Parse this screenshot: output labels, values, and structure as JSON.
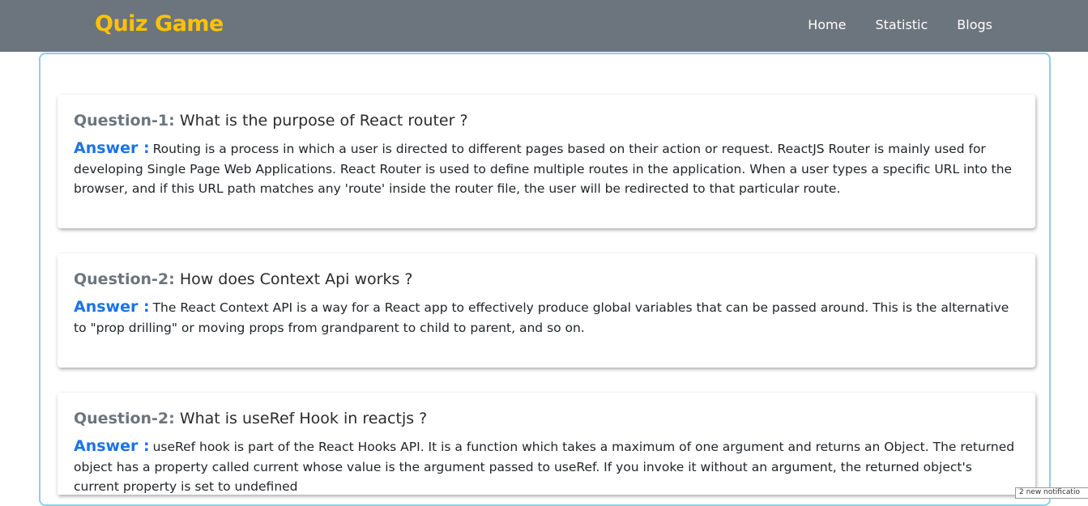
{
  "navbar": {
    "brand": "Quiz Game",
    "links": [
      "Home",
      "Statistic",
      "Blogs"
    ],
    "background": "#6c757d",
    "brand_color": "#ffc107"
  },
  "accent": {
    "answer_label": "#1a73e8",
    "frame_border": "#8ecfe6"
  },
  "qa": [
    {
      "number": "Question-1:",
      "question": "What is the purpose of React router ?",
      "answer_label": "Answer :",
      "answer": "Routing is a process in which a user is directed to different pages based on their action or request. ReactJS Router is mainly used for developing Single Page Web Applications. React Router is used to define multiple routes in the application. When a user types a specific URL into the browser, and if this URL path matches any 'route' inside the router file, the user will be redirected to that particular route."
    },
    {
      "number": "Question-2:",
      "question": "How does Context Api works ?",
      "answer_label": "Answer :",
      "answer": "The React Context API is a way for a React app to effectively produce global variables that can be passed around. This is the alternative to \"prop drilling\" or moving props from grandparent to child to parent, and so on."
    },
    {
      "number": "Question-2:",
      "question": "What is useRef Hook in reactjs ?",
      "answer_label": "Answer :",
      "answer": "useRef hook is part of the React Hooks API. It is a function which takes a maximum of one argument and returns an Object. The returned object has a property called current whose value is the argument passed to useRef. If you invoke it without an argument, the returned object's current property is set to undefined"
    }
  ],
  "notification": {
    "text": "2 new notificatio"
  }
}
